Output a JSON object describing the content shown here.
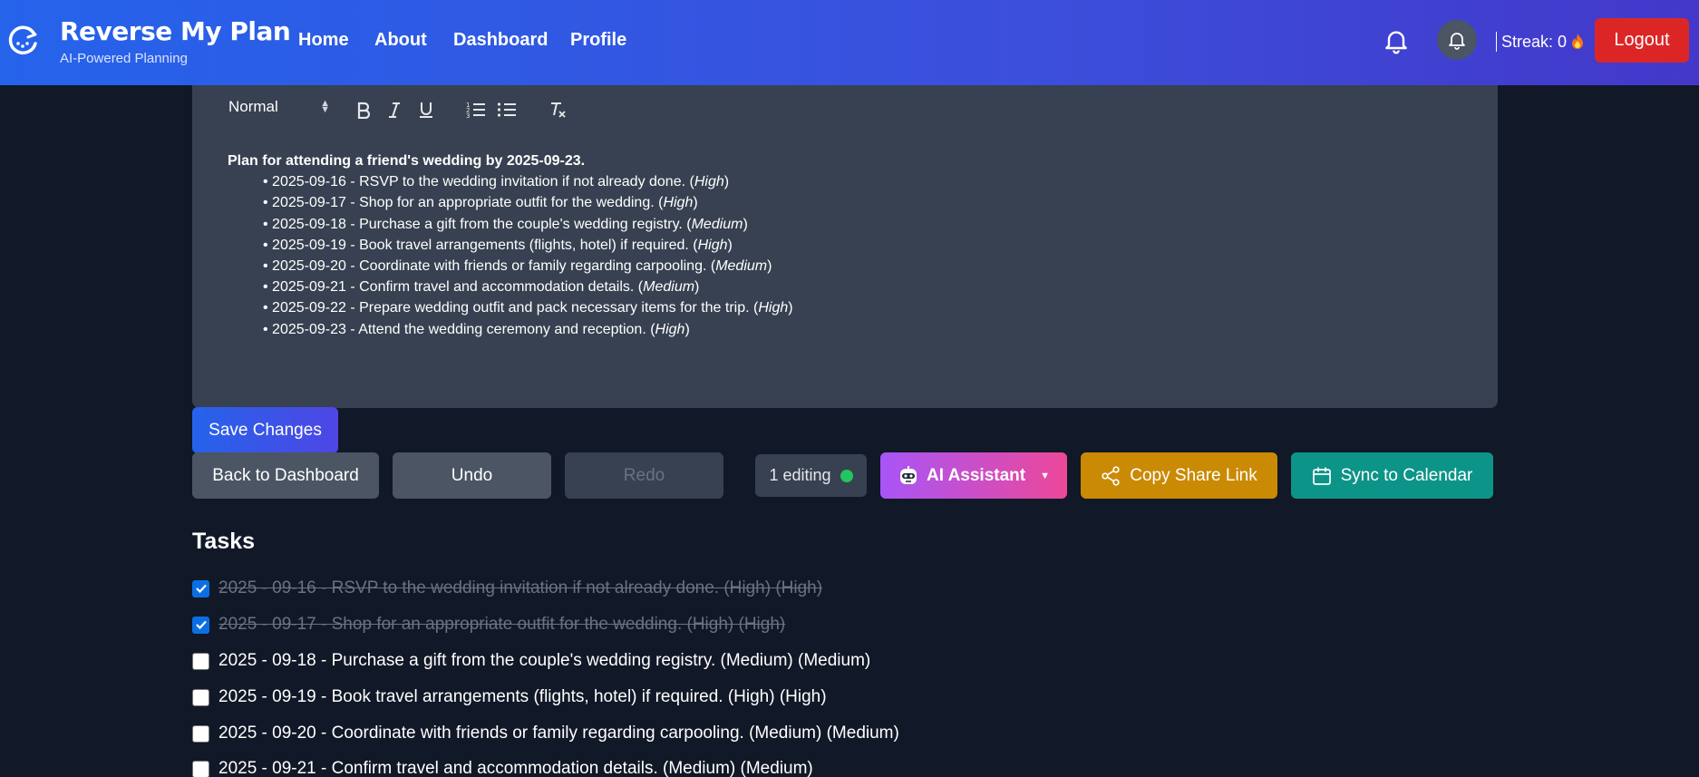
{
  "brand": {
    "title": "Reverse My Plan",
    "subtitle": "AI-Powered Planning"
  },
  "nav": {
    "links": [
      "Home",
      "About",
      "Dashboard",
      "Profile"
    ]
  },
  "header": {
    "streak_label": "Streak: 0",
    "streak_icon": "fire-icon",
    "logout_label": "Logout"
  },
  "toolbar": {
    "format_value": "Normal"
  },
  "editor": {
    "title": "Plan for attending a friend's wedding by 2025-09-23.",
    "items": [
      {
        "text": "2025-09-16 - RSVP to the wedding invitation if not already done. (",
        "priority": "High"
      },
      {
        "text": "2025-09-17 - Shop for an appropriate outfit for the wedding. (",
        "priority": "High"
      },
      {
        "text": "2025-09-18 - Purchase a gift from the couple's wedding registry. (",
        "priority": "Medium"
      },
      {
        "text": "2025-09-19 - Book travel arrangements (flights, hotel) if required. (",
        "priority": "High"
      },
      {
        "text": "2025-09-20 - Coordinate with friends or family regarding carpooling. (",
        "priority": "Medium"
      },
      {
        "text": "2025-09-21 - Confirm travel and accommodation details. (",
        "priority": "Medium"
      },
      {
        "text": "2025-09-22 - Prepare wedding outfit and pack necessary items for the trip. (",
        "priority": "High"
      },
      {
        "text": "2025-09-23 - Attend the wedding ceremony and reception. (",
        "priority": "High"
      }
    ]
  },
  "actions": {
    "save": "Save Changes",
    "back": "Back to Dashboard",
    "undo": "Undo",
    "redo": "Redo",
    "editing": "1 editing",
    "ai": "AI Assistant",
    "share": "Copy Share Link",
    "sync": "Sync to Calendar"
  },
  "tasks": {
    "title": "Tasks",
    "items": [
      {
        "label": "2025 - 09-16 - RSVP to the wedding invitation if not already done. (High) (High)",
        "checked": true
      },
      {
        "label": "2025 - 09-17 - Shop for an appropriate outfit for the wedding. (High) (High)",
        "checked": true
      },
      {
        "label": "2025 - 09-18 - Purchase a gift from the couple's wedding registry. (Medium) (Medium)",
        "checked": false
      },
      {
        "label": "2025 - 09-19 - Book travel arrangements (flights, hotel) if required. (High) (High)",
        "checked": false
      },
      {
        "label": "2025 - 09-20 - Coordinate with friends or family regarding carpooling. (Medium) (Medium)",
        "checked": false
      },
      {
        "label": "2025 - 09-21 - Confirm travel and accommodation details. (Medium) (Medium)",
        "checked": false
      }
    ]
  },
  "colors": {
    "nav_gradient_start": "#2563eb",
    "nav_gradient_end": "#4338ca",
    "background": "#111827",
    "editor_bg": "#374151",
    "logout": "#dc2626",
    "ai_gradient_start": "#a855f7",
    "ai_gradient_end": "#ec4899",
    "share": "#ca8a04",
    "sync": "#0d9488",
    "editing_dot": "#22c55e",
    "checkbox_checked": "#0b6fe3"
  }
}
